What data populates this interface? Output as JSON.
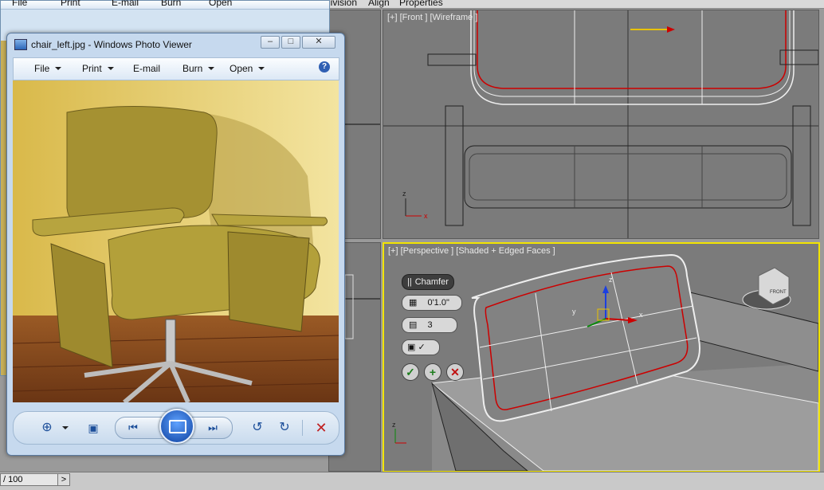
{
  "max": {
    "menu": {
      "division": "division",
      "align": "Align",
      "properties": "Properties"
    },
    "viewport_front_label": "[+] [Front ] [Wireframe ]",
    "viewport_persp_label": "[+] [Perspective ] [Shaded + Edged Faces ]",
    "viewcube_label": "FRONT",
    "caddy": {
      "title": "Chamfer",
      "amount": "0'1.0\"",
      "segments": "3"
    },
    "axis": {
      "z": "z",
      "x": "x",
      "y": "y"
    },
    "timeline": {
      "frame": "/ 100",
      "next": ">"
    }
  },
  "back_window": {
    "menu": {
      "file": "File",
      "print": "Print",
      "email": "E-mail",
      "burn": "Burn",
      "open": "Open"
    }
  },
  "photo_viewer": {
    "title": "chair_left.jpg - Windows Photo Viewer",
    "menu": {
      "file": "File",
      "print": "Print",
      "email": "E-mail",
      "burn": "Burn",
      "open": "Open"
    },
    "help": "?",
    "min": "–",
    "max": "□",
    "close": "✕"
  },
  "colors": {
    "highlight": "#f2e400",
    "select_edge": "#d01010",
    "wire": "#ffffff"
  }
}
